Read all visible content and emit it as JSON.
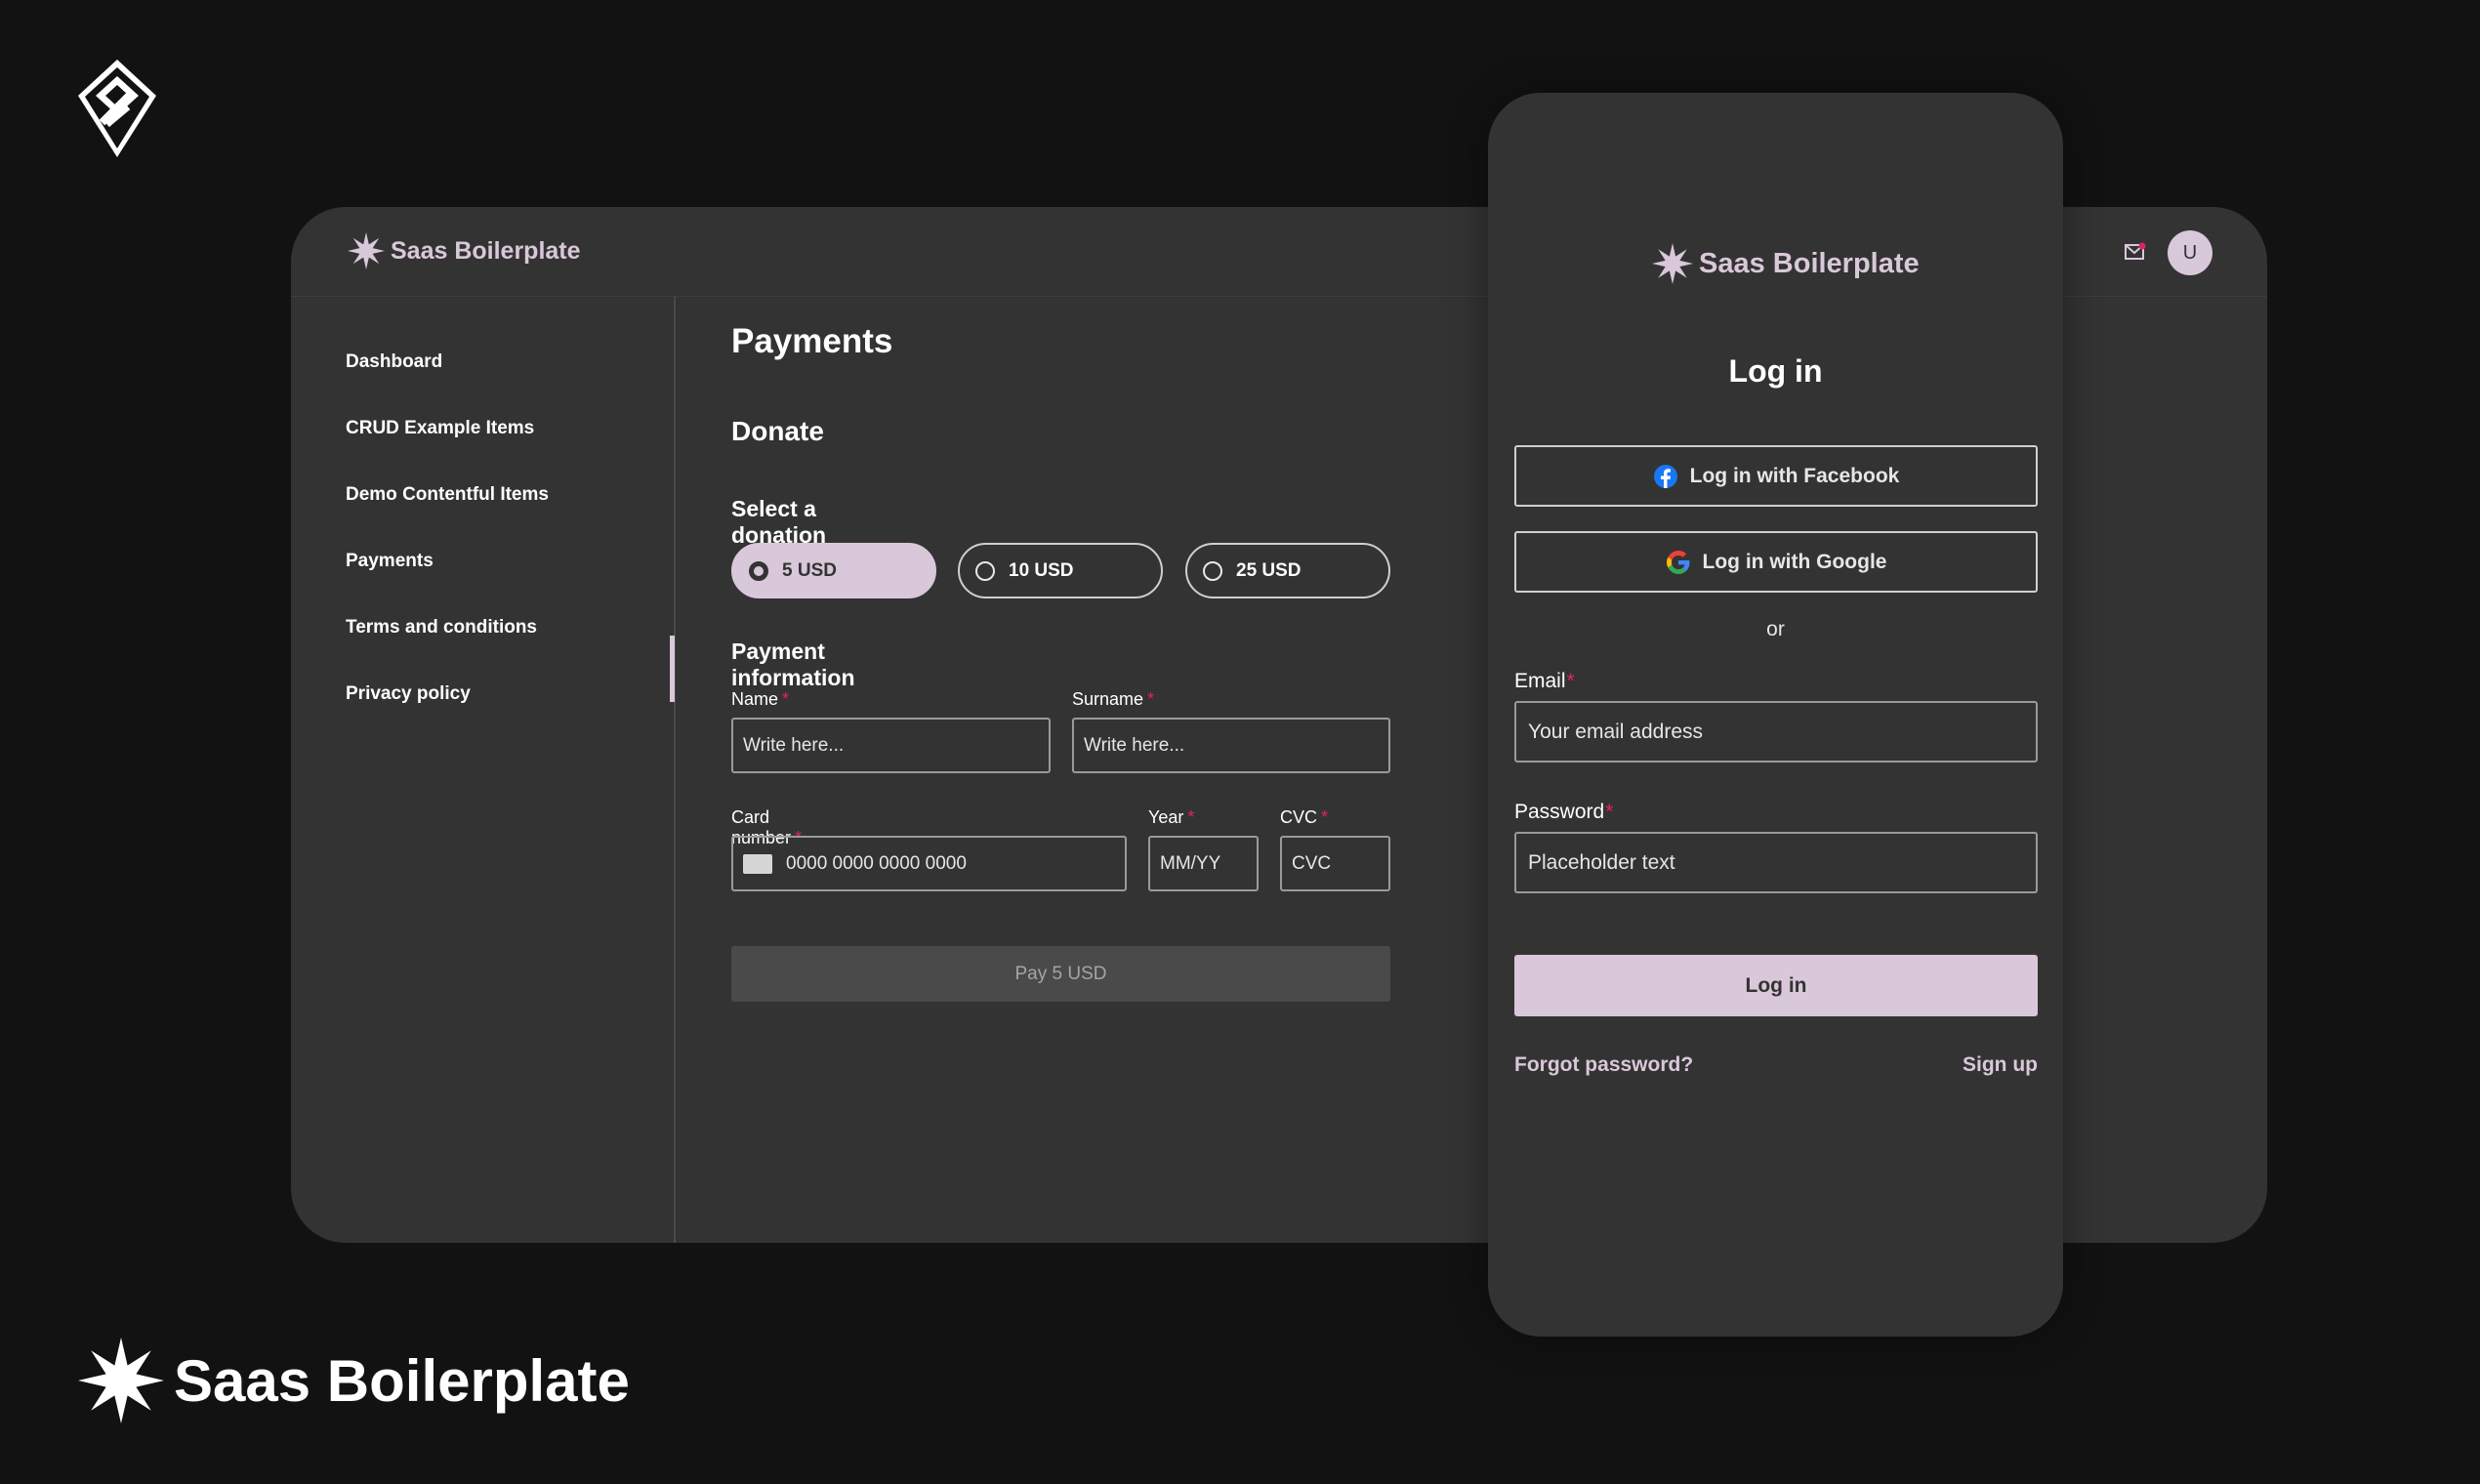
{
  "brand": {
    "name": "Saas Boilerplate"
  },
  "desktop": {
    "avatar_initial": "U",
    "sidebar": {
      "items": [
        {
          "label": "Dashboard"
        },
        {
          "label": "CRUD Example Items"
        },
        {
          "label": "Demo Contentful Items"
        },
        {
          "label": "Payments",
          "active": true
        },
        {
          "label": "Terms and conditions"
        },
        {
          "label": "Privacy policy"
        }
      ]
    },
    "page_title": "Payments",
    "section_title": "Donate",
    "select_label": "Select a donation",
    "donations": [
      {
        "label": "5 USD",
        "selected": true
      },
      {
        "label": "10 USD",
        "selected": false
      },
      {
        "label": "25 USD",
        "selected": false
      }
    ],
    "payment_info_title": "Payment information",
    "fields": {
      "name": {
        "label": "Name",
        "placeholder": "Write here..."
      },
      "surname": {
        "label": "Surname",
        "placeholder": "Write here..."
      },
      "card": {
        "label": "Card number",
        "placeholder": "0000 0000 0000 0000"
      },
      "year": {
        "label": "Year",
        "placeholder": "MM/YY"
      },
      "cvc": {
        "label": "CVC",
        "placeholder": "CVC"
      }
    },
    "required_marker": "*",
    "pay_button": "Pay 5 USD"
  },
  "login": {
    "title": "Log in",
    "facebook_button": "Log in with Facebook",
    "google_button": "Log in with Google",
    "or_text": "or",
    "email_label": "Email",
    "email_placeholder": "Your email address",
    "password_label": "Password",
    "password_placeholder": "Placeholder text",
    "submit_button": "Log in",
    "forgot_link": "Forgot password?",
    "signup_link": "Sign up"
  },
  "colors": {
    "accent": "#d9c8d9",
    "background": "#121212",
    "panel": "#333333",
    "required": "#e0245e"
  }
}
